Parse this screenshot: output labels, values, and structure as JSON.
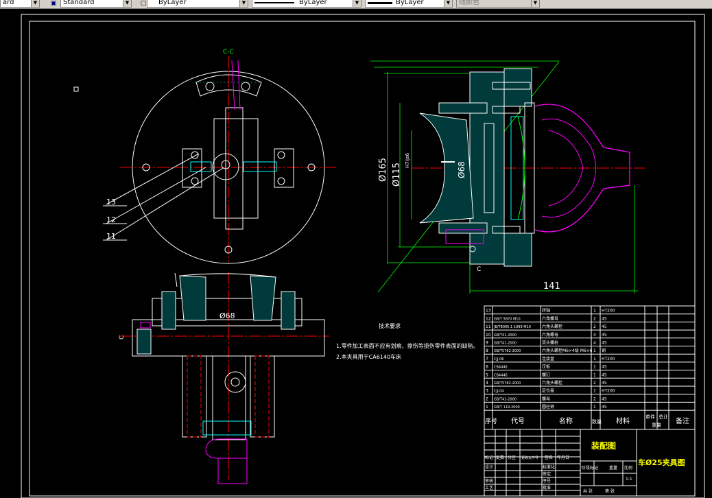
{
  "toolbar": {
    "combo1": "ard",
    "combo2": "Standard",
    "combo3": "ByLayer",
    "combo4": "ByLayer",
    "combo5": "ByLayer",
    "combo6": "随颜色"
  },
  "drawing": {
    "section_label": "C-C",
    "part_numbers": [
      "13",
      "12",
      "11"
    ],
    "dim_68_top": "Ø68",
    "dim_68_right": "Ø68",
    "dim_165": "Ø165",
    "dim_115": "Ø115",
    "dim_115_fit": "H7/js6",
    "dim_141": "141",
    "c_mark_left": "C",
    "c_mark_right": "C",
    "tech_title": "技术要求",
    "tech_1": "1.零件加工表面不应有划痕、擦伤等损伤零件表面的缺陷。",
    "tech_2": "2.本夹具用于CA6140车床"
  },
  "bom": {
    "rows": [
      {
        "no": "13",
        "code": "",
        "name": "转轴",
        "qty": "1",
        "mat": "HT200"
      },
      {
        "no": "12",
        "code": "GB/T 5870 M10",
        "name": "六角螺母",
        "qty": "2",
        "mat": "45"
      },
      {
        "no": "11",
        "code": "JB/T8005.1-1999 M10",
        "name": "六角头螺栓",
        "qty": "2",
        "mat": "45"
      },
      {
        "no": "10",
        "code": "GB/T41-2000",
        "name": "六角螺母",
        "qty": "4",
        "mat": "45"
      },
      {
        "no": "9",
        "code": "GB/T41-2000",
        "name": "双头螺柱",
        "qty": "4",
        "mat": "45"
      },
      {
        "no": "8",
        "code": "GB/T5782-2000",
        "name": "六角头螺栓M6×4级 M6×6",
        "qty": "1",
        "mat": "钢"
      },
      {
        "no": "7",
        "code": "CJJ-06",
        "name": "连接盘",
        "qty": "1",
        "mat": "HT200"
      },
      {
        "no": "6",
        "code": "CB4446",
        "name": "压板",
        "qty": "1",
        "mat": "45"
      },
      {
        "no": "5",
        "code": "CB4446",
        "name": "螺钉",
        "qty": "1",
        "mat": "45"
      },
      {
        "no": "4",
        "code": "GB/T5782-2000",
        "name": "六角头螺栓",
        "qty": "2",
        "mat": "45"
      },
      {
        "no": "3",
        "code": "CJJ-04",
        "name": "定位盘",
        "qty": "1",
        "mat": "HT200"
      },
      {
        "no": "2",
        "code": "GB/T41-2000",
        "name": "螺母",
        "qty": "2",
        "mat": "45"
      },
      {
        "no": "1",
        "code": "GB/T 119-2000",
        "name": "圆柱销",
        "qty": "1",
        "mat": "45"
      }
    ],
    "header": {
      "no": "序号",
      "code": "代号",
      "name": "名称",
      "qty": "数量",
      "mat": "材料",
      "unit": "单件",
      "total": "总计",
      "weight": "重量",
      "note": "备注"
    }
  },
  "title_block": {
    "main_title": "装配图",
    "drawing_name": "车Ø25夹具图",
    "marks": "标记",
    "count": "处数",
    "zone": "分区",
    "change_doc": "更改文件号",
    "sign": "签名",
    "date": "年月日",
    "design": "设计",
    "standardize": "标准化",
    "review": "审核",
    "process": "工艺",
    "approve": "批准",
    "stage": "阶段标记",
    "weight": "重量",
    "ratio": "比例",
    "ratio_val": "1:1",
    "sheet_total": "共 张",
    "sheet_no": "第 张",
    "seq": "序号",
    "check": "审定"
  }
}
